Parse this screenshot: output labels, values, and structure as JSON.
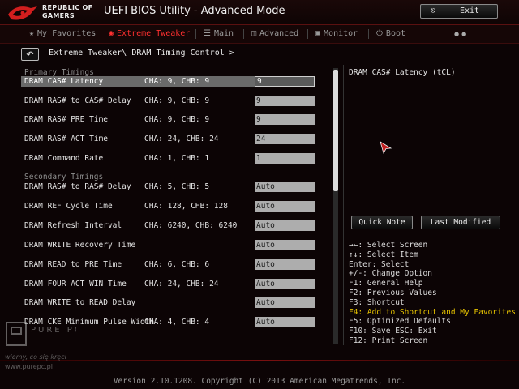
{
  "header": {
    "brand_line1": "REPUBLIC OF",
    "brand_line2": "GAMERS",
    "title": "UEFI BIOS Utility - Advanced Mode",
    "exit_label": "Exit"
  },
  "tabs": [
    {
      "label": "My Favorites",
      "icon": "star-icon",
      "active": false
    },
    {
      "label": "Extreme Tweaker",
      "icon": "tweaker-icon",
      "active": true
    },
    {
      "label": "Main",
      "icon": "list-icon",
      "active": false
    },
    {
      "label": "Advanced",
      "icon": "advanced-icon",
      "active": false
    },
    {
      "label": "Monitor",
      "icon": "monitor-icon",
      "active": false
    },
    {
      "label": "Boot",
      "icon": "power-icon",
      "active": false
    }
  ],
  "breadcrumb": "Extreme Tweaker\\ DRAM Timing Control >",
  "sections": {
    "primary": "Primary Timings",
    "secondary": "Secondary Timings"
  },
  "rows": [
    {
      "label": "DRAM CAS# Latency",
      "channels": "CHA:   9, CHB:   9",
      "value": "9",
      "selected": true
    },
    {
      "label": "DRAM RAS# to CAS# Delay",
      "channels": "CHA:   9, CHB:   9",
      "value": "9"
    },
    {
      "label": "DRAM RAS# PRE Time",
      "channels": "CHA:   9, CHB:   9",
      "value": "9"
    },
    {
      "label": "DRAM RAS# ACT Time",
      "channels": "CHA:  24, CHB:  24",
      "value": "24"
    },
    {
      "label": "DRAM Command Rate",
      "channels": "CHA:   1, CHB:   1",
      "value": "1"
    },
    {
      "label": "DRAM RAS# to RAS# Delay",
      "channels": "CHA:   5, CHB:   5",
      "value": "Auto"
    },
    {
      "label": "DRAM REF Cycle Time",
      "channels": "CHA: 128, CHB: 128",
      "value": "Auto"
    },
    {
      "label": "DRAM Refresh Interval",
      "channels": "CHA: 6240, CHB: 6240",
      "value": "Auto"
    },
    {
      "label": "DRAM WRITE Recovery Time",
      "channels": "",
      "value": "Auto"
    },
    {
      "label": "DRAM READ to PRE Time",
      "channels": "CHA:   6, CHB:   6",
      "value": "Auto"
    },
    {
      "label": "DRAM FOUR ACT WIN Time",
      "channels": "CHA:  24, CHB:  24",
      "value": "Auto"
    },
    {
      "label": "DRAM WRITE to READ Delay",
      "channels": "",
      "value": "Auto"
    },
    {
      "label": "DRAM CKE Minimum Pulse Width",
      "channels": "CHA:   4, CHB:   4",
      "value": "Auto"
    }
  ],
  "help": {
    "title": "DRAM CAS# Latency (tCL)"
  },
  "buttons": {
    "quick_note": "Quick Note",
    "last_modified": "Last Modified"
  },
  "keys": [
    {
      "text": "→←: Select Screen",
      "highlight": false
    },
    {
      "text": "↑↓: Select Item",
      "highlight": false
    },
    {
      "text": "Enter: Select",
      "highlight": false
    },
    {
      "text": "+/-: Change Option",
      "highlight": false
    },
    {
      "text": "F1: General Help",
      "highlight": false
    },
    {
      "text": "F2: Previous Values",
      "highlight": false
    },
    {
      "text": "F3: Shortcut",
      "highlight": false
    },
    {
      "text": "F4: Add to Shortcut and My Favorites",
      "highlight": true
    },
    {
      "text": "F5: Optimized Defaults",
      "highlight": false
    },
    {
      "text": "F10: Save  ESC: Exit",
      "highlight": false
    },
    {
      "text": "F12: Print Screen",
      "highlight": false
    }
  ],
  "footer": "Version 2.10.1208. Copyright (C) 2013 American Megatrends, Inc.",
  "watermark": {
    "brand": "PURE PC",
    "line1": "wiemy, co się kręci",
    "line2": "www.purepc.pl"
  },
  "colors": {
    "accent": "#ff3030",
    "highlight_key": "#e6c300",
    "background": "#0c0405"
  }
}
